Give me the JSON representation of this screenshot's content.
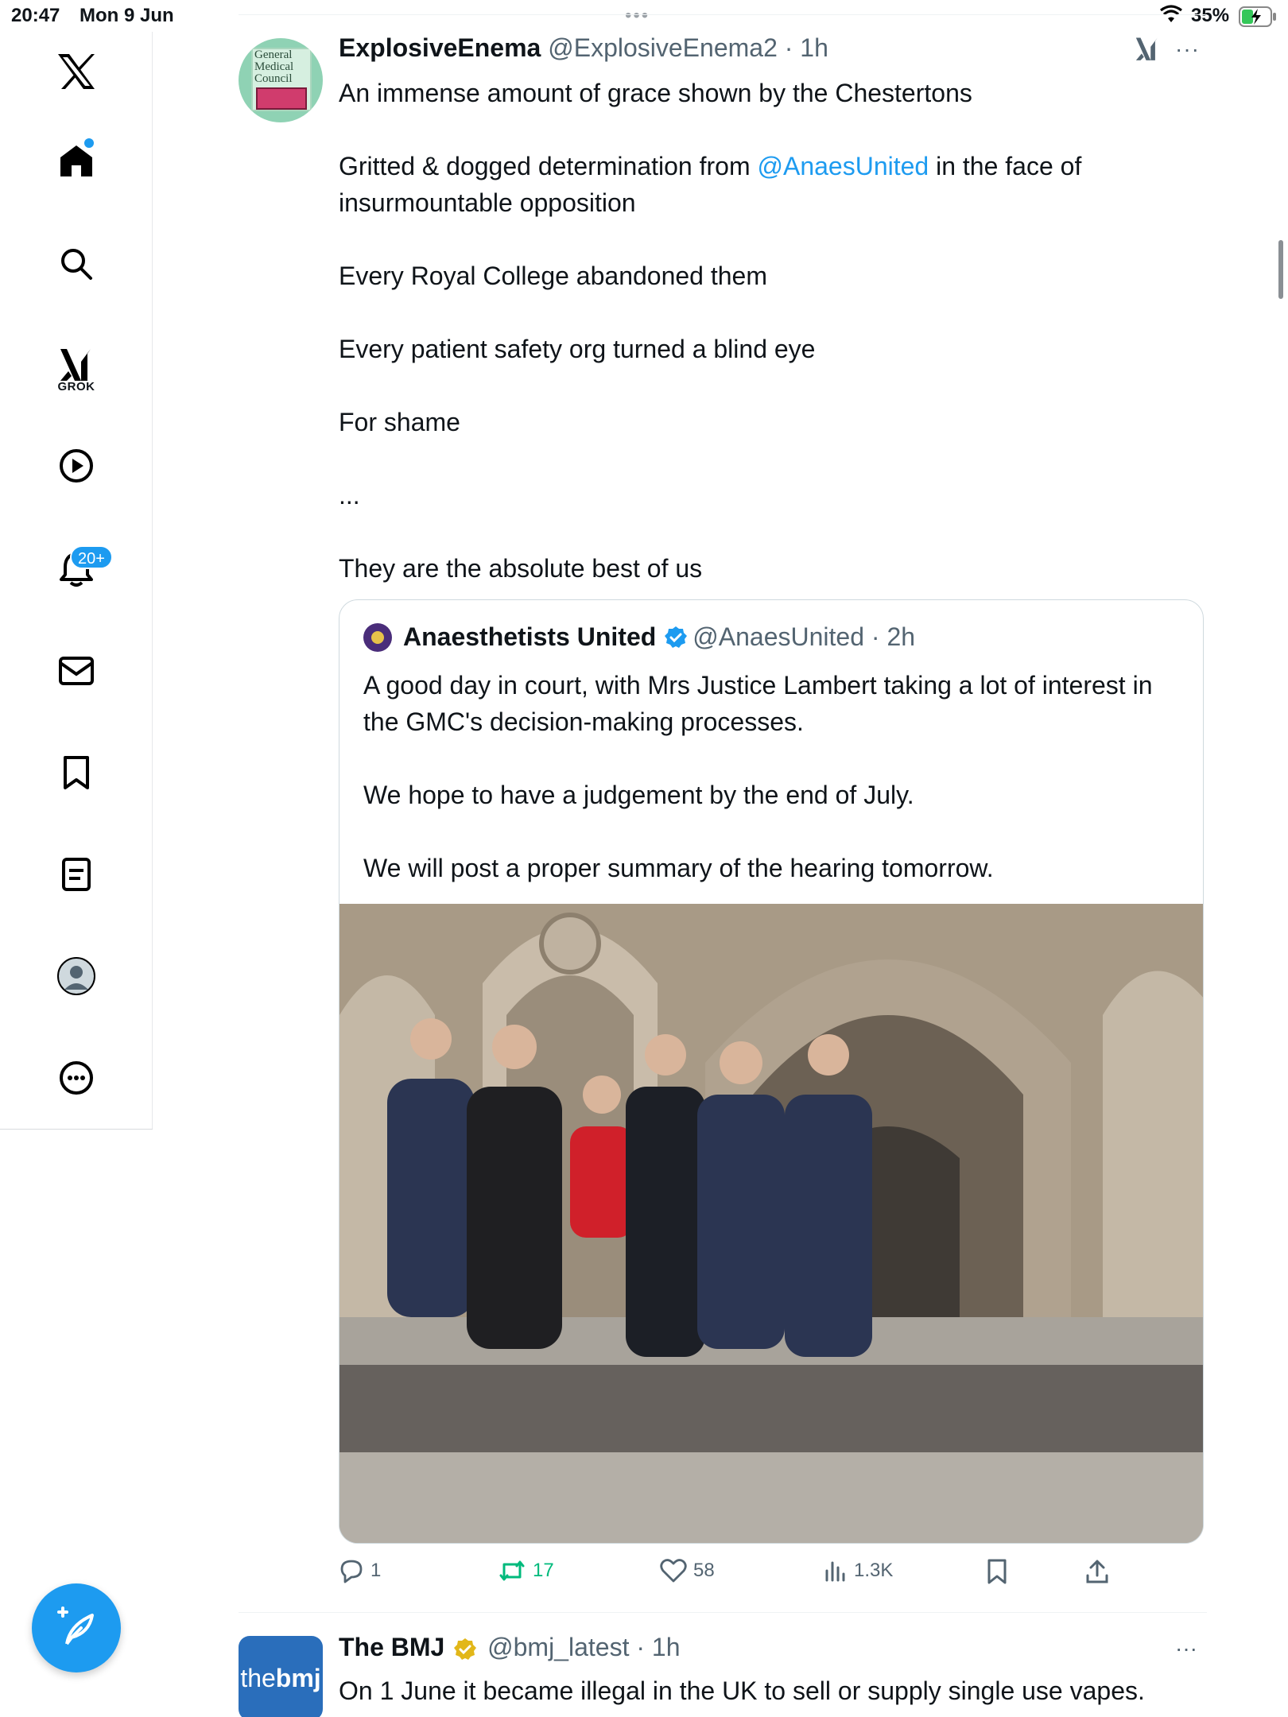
{
  "status_bar": {
    "time": "20:47",
    "date": "Mon 9 Jun",
    "battery": "35%"
  },
  "sidebar": {
    "grok_label": "GROK",
    "notifications_badge": "20+"
  },
  "tweet": {
    "name": "ExplosiveEnema",
    "handle": "@ExplosiveEnema2",
    "time": "1h",
    "avatar_text": "General Medical Council",
    "lines": [
      "An immense amount of grace shown by the Chestertons",
      "Every Royal College abandoned them",
      "Every patient safety org turned a blind eye",
      "For shame",
      "...",
      "They are the absolute best of us"
    ],
    "line2_pre": "Gritted & dogged determination from ",
    "line2_mention": "@AnaesUnited",
    "line2_post": " in the face of insurmountable opposition",
    "quote": {
      "name": "Anaesthetists United",
      "handle": "@AnaesUnited",
      "time": "2h",
      "lines": [
        "A good day in court, with Mrs Justice Lambert taking a lot of interest in the GMC's decision-making processes.",
        "We hope to have a judgement by the end of July.",
        "We will post a proper summary of the hearing tomorrow."
      ]
    },
    "stats": {
      "replies": "1",
      "reposts": "17",
      "likes": "58",
      "views": "1.3K"
    }
  },
  "tweet2": {
    "name": "The BMJ",
    "handle": "@bmj_latest",
    "time": "1h",
    "avatar_text_a": "the",
    "avatar_text_b": "bmj",
    "text": "On 1 June it became illegal in the UK to sell or supply single use vapes."
  },
  "colors": {
    "accent": "#1d9bf0",
    "repost": "#00ba7c",
    "muted": "#536471",
    "verified_gold": "#e2b719"
  }
}
